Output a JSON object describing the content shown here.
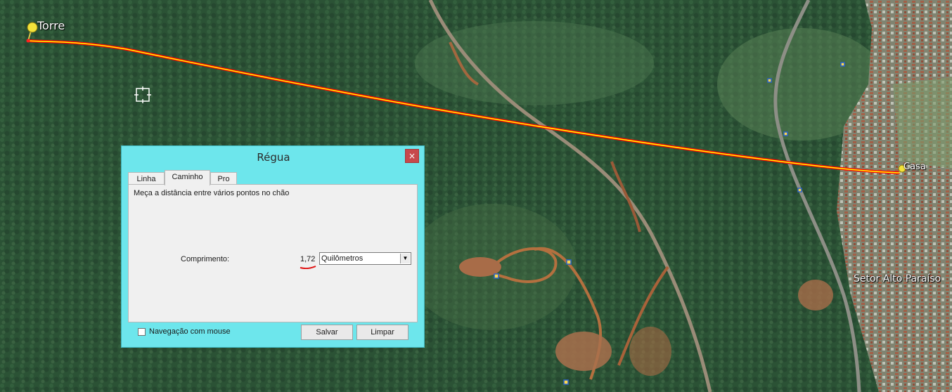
{
  "map": {
    "placemarks": [
      {
        "label": "Torre",
        "icon": "yellow-pushpin-icon"
      },
      {
        "label": "Casa",
        "icon": "yellow-pushpin-icon"
      }
    ],
    "area_label": "Setor Alto Paraíso",
    "measure_path_colors": {
      "outer": "#ff0000",
      "inner": "#ffff00"
    }
  },
  "dialog": {
    "title": "Régua",
    "close_label": "×",
    "tabs": [
      {
        "label": "Linha",
        "active": false
      },
      {
        "label": "Caminho",
        "active": true
      },
      {
        "label": "Pro",
        "active": false
      }
    ],
    "description": "Meça a distância entre vários pontos no chão",
    "length_label": "Comprimento:",
    "length_value": "1,72",
    "unit_selected": "Quilômetros",
    "mouse_nav_label": "Navegação com mouse",
    "mouse_nav_checked": false,
    "save_label": "Salvar",
    "clear_label": "Limpar",
    "colors": {
      "title_bar": "#6de6ec",
      "close_button": "#c7484b"
    }
  }
}
